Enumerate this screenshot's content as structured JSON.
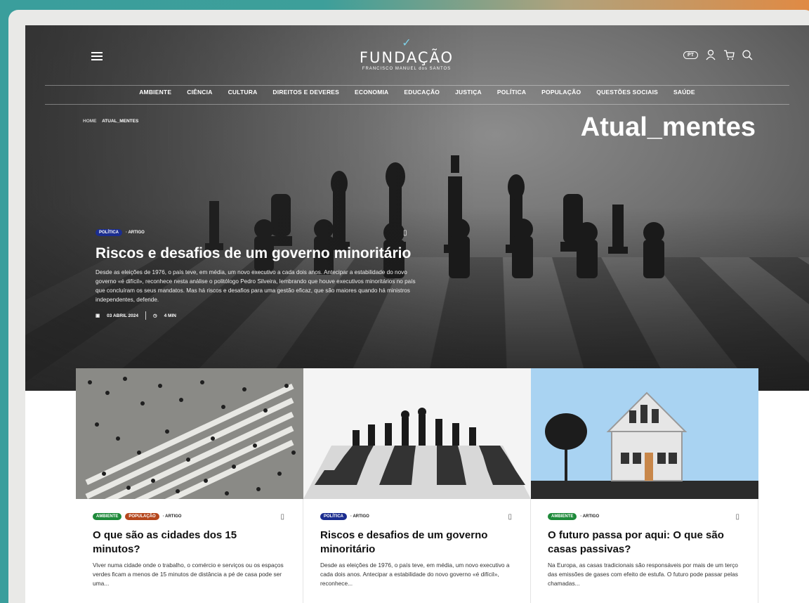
{
  "header": {
    "brand": "FUNDAÇÃO",
    "brand_sub": "FRANCISCO MANUEL dos SANTOS",
    "lang": "PT",
    "nav": [
      "AMBIENTE",
      "CIÊNCIA",
      "CULTURA",
      "DIREITOS E DEVERES",
      "ECONOMIA",
      "EDUCAÇÃO",
      "JUSTIÇA",
      "POLÍTICA",
      "POPULAÇÃO",
      "QUESTÕES SOCIAIS",
      "SAÚDE"
    ]
  },
  "breadcrumb": {
    "home": "HOME",
    "current": "ATUAL_MENTES"
  },
  "hero": {
    "title": "Atual_mentes",
    "tag": "POLÍTICA",
    "kind": "· ARTIGO",
    "headline": "Riscos e desafios de um governo minoritário",
    "excerpt": "Desde as eleições de 1976, o país teve, em média, um novo executivo a cada dois anos. Antecipar a estabilidade do novo governo «é difícil», reconhece nesta análise o politólogo Pedro Silveira, lembrando que houve executivos minoritários no país que concluíram os seus mandatos. Mas há riscos e desafios para uma gestão eficaz, que são maiores quando há ministros independentes, defende.",
    "date": "03 ABRIL 2024",
    "read_time": "4 MIN"
  },
  "cards": [
    {
      "tags": [
        "AMBIENTE",
        "POPULAÇÃO"
      ],
      "kind": "· ARTIGO",
      "title": "O que são as cidades dos 15 minutos?",
      "excerpt": "Viver numa cidade onde o trabalho, o comércio e serviços ou os espaços verdes ficam a menos de 15 minutos de distância a pé de casa pode ser uma..."
    },
    {
      "tags": [
        "POLÍTICA"
      ],
      "kind": "· ARTIGO",
      "title": "Riscos e desafios de um governo minoritário",
      "excerpt": "Desde as eleições de 1976, o país teve, em média, um novo executivo a cada dois anos. Antecipar a estabilidade do novo governo «é difícil», reconhece..."
    },
    {
      "tags": [
        "AMBIENTE"
      ],
      "kind": "· ARTIGO",
      "title": "O futuro passa por aqui: O que são casas passivas?",
      "excerpt": "Na Europa, as casas tradicionais são responsáveis por mais de um terço das emissões de gases com efeito de estufa. O futuro pode passar pelas chamadas..."
    }
  ],
  "colors": {
    "politica": "#1b2d8f",
    "ambiente": "#1e8a3a",
    "populacao": "#b5471d"
  },
  "icons": [
    "menu-icon",
    "user-icon",
    "cart-icon",
    "search-icon",
    "bookmark-icon",
    "calendar-icon",
    "clock-icon"
  ]
}
